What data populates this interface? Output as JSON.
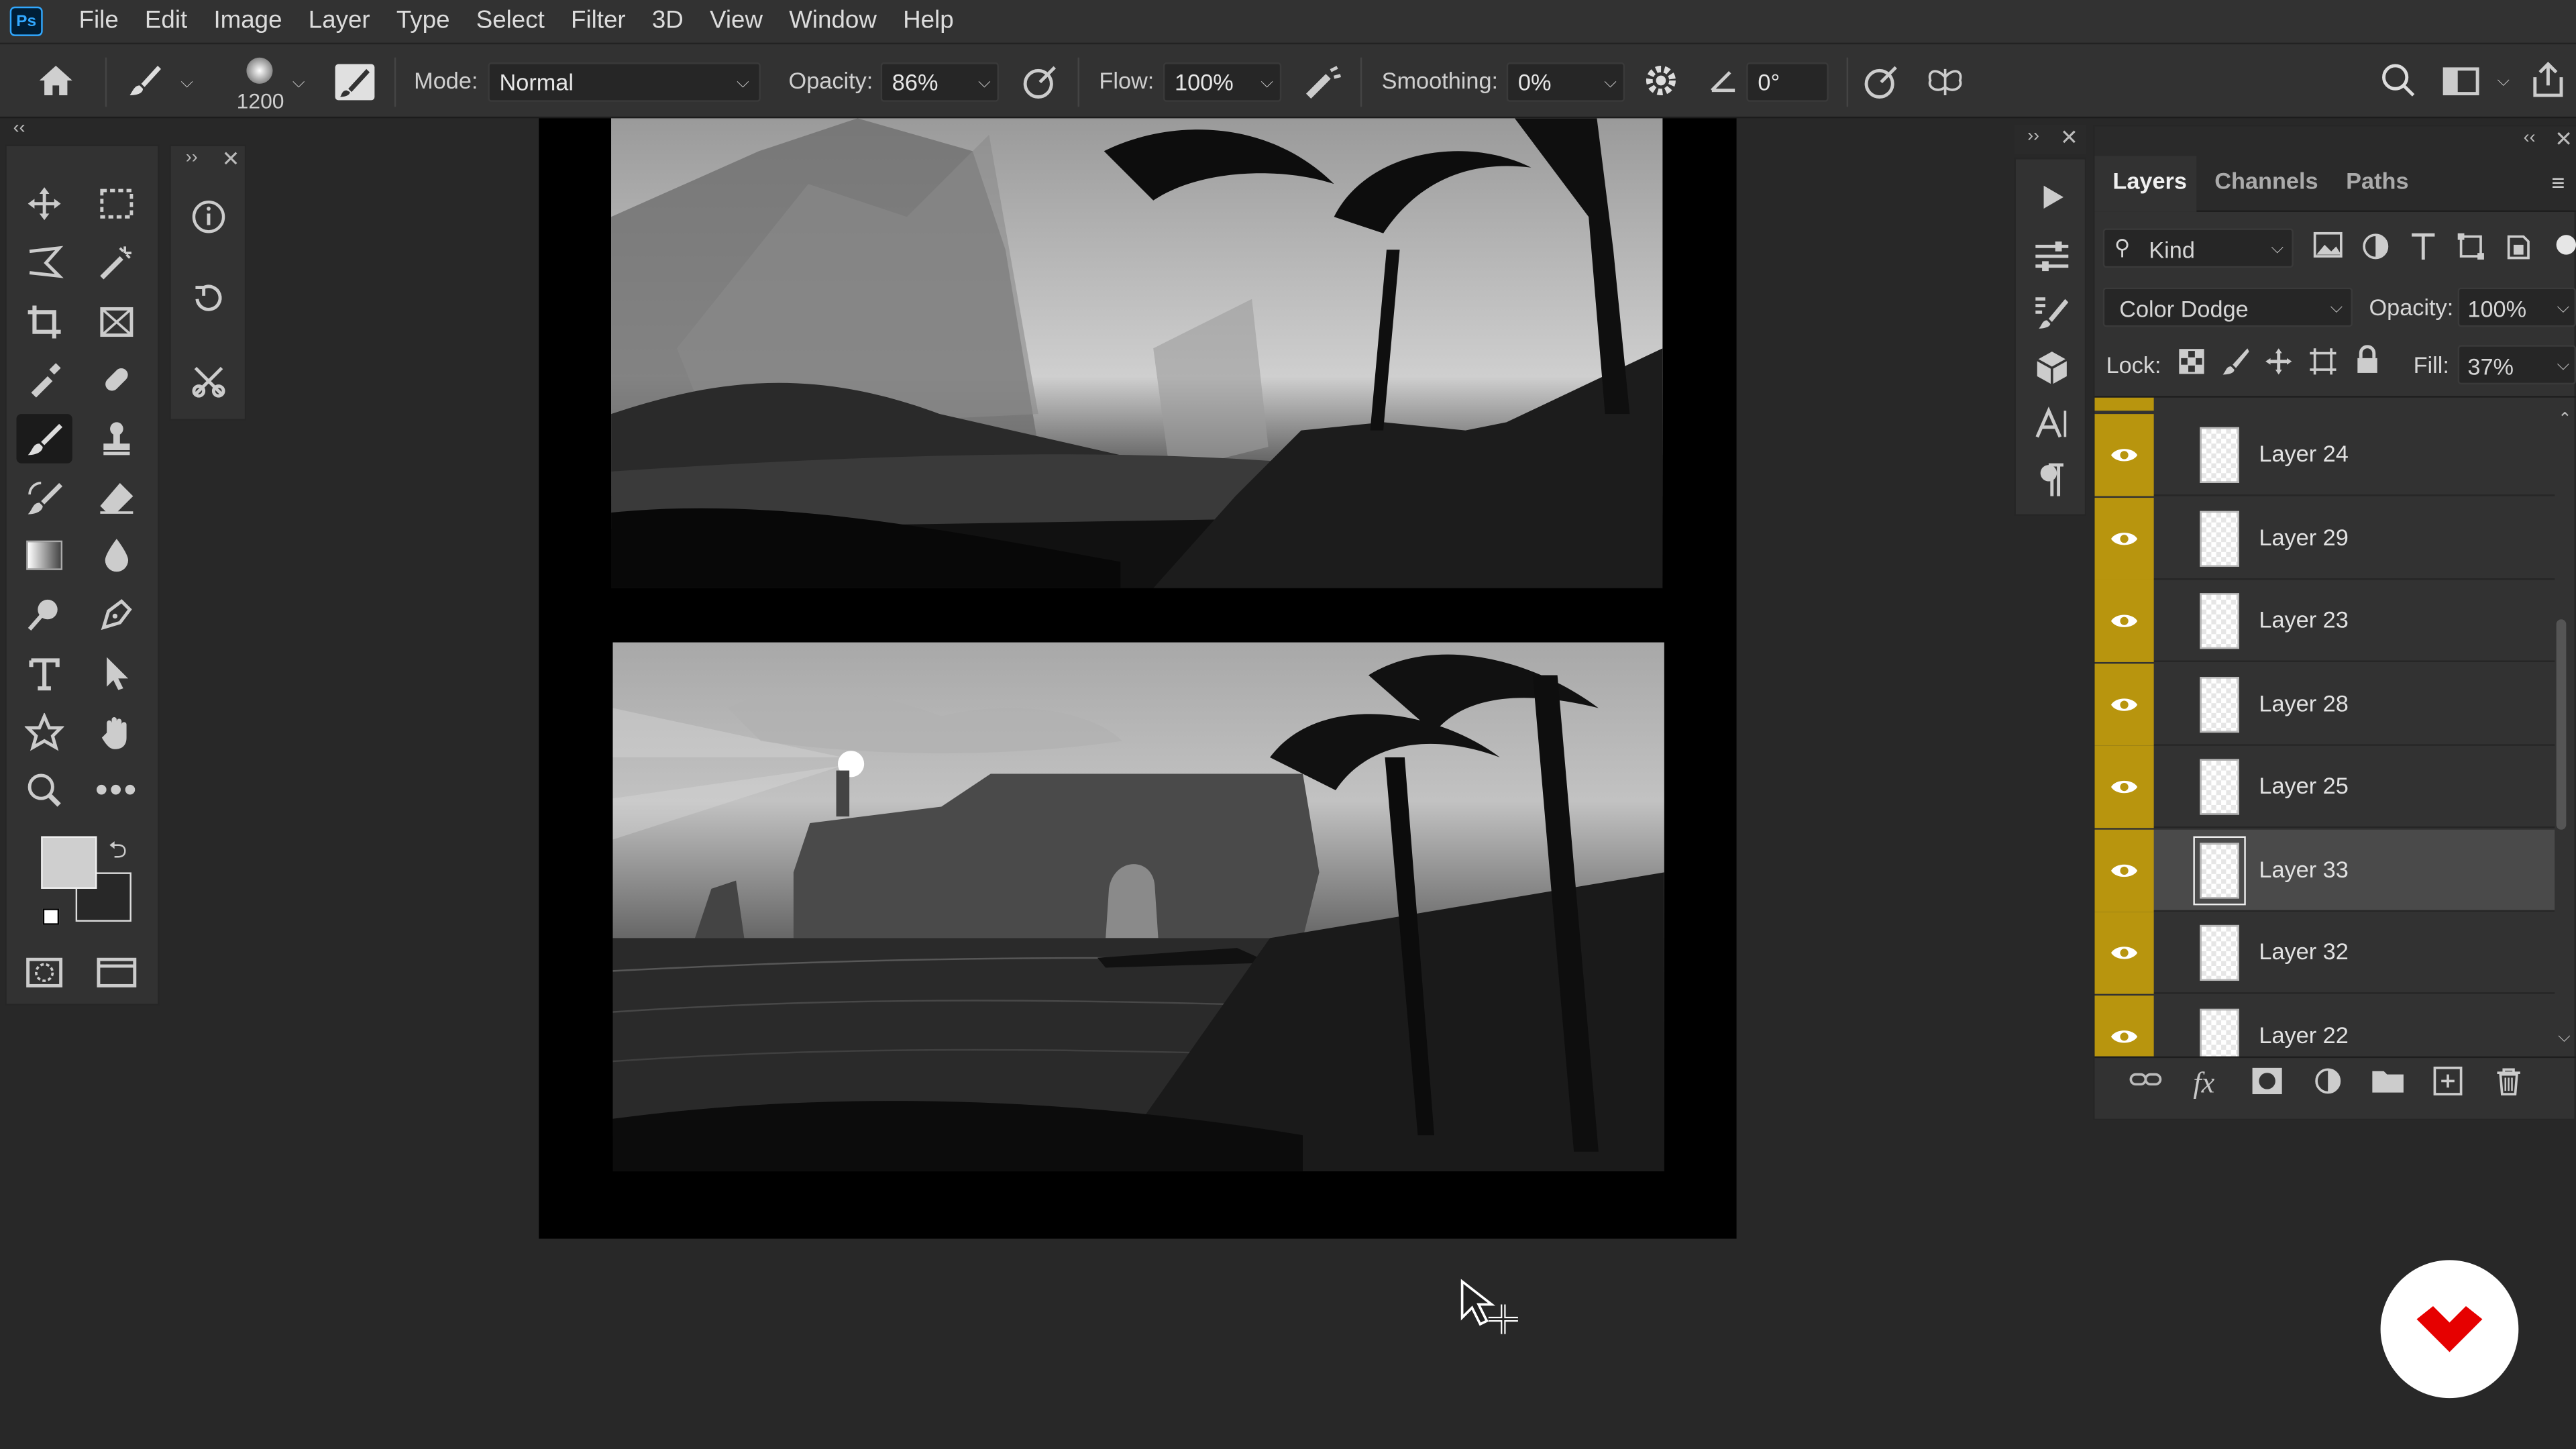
{
  "app": {
    "logo": "Ps"
  },
  "menu": [
    "File",
    "Edit",
    "Image",
    "Layer",
    "Type",
    "Select",
    "Filter",
    "3D",
    "View",
    "Window",
    "Help"
  ],
  "options": {
    "brush_size": "1200",
    "mode_label": "Mode:",
    "mode_value": "Normal",
    "opacity_label": "Opacity:",
    "opacity_value": "86%",
    "flow_label": "Flow:",
    "flow_value": "100%",
    "smoothing_label": "Smoothing:",
    "smoothing_value": "0%",
    "angle_value": "0°"
  },
  "tools": [
    "move-tool",
    "marquee-tool",
    "lasso-tool",
    "magic-wand-tool",
    "crop-tool",
    "frame-tool",
    "eyedropper-tool",
    "healing-tool",
    "brush-tool",
    "stamp-tool",
    "history-brush-tool",
    "eraser-tool",
    "gradient-tool",
    "blur-tool",
    "dodge-tool",
    "pen-tool",
    "type-tool",
    "path-selection-tool",
    "shape-tool",
    "hand-tool",
    "zoom-tool",
    "more-tools"
  ],
  "layers_panel": {
    "tabs": [
      "Layers",
      "Channels",
      "Paths"
    ],
    "filter_kind": "Kind",
    "blend_mode": "Color Dodge",
    "opacity_label": "Opacity:",
    "opacity_value": "100%",
    "lock_label": "Lock:",
    "fill_label": "Fill:",
    "fill_value": "37%",
    "layers": [
      {
        "name": "Layer 24",
        "visible": true,
        "selected": false
      },
      {
        "name": "Layer 29",
        "visible": true,
        "selected": false
      },
      {
        "name": "Layer 23",
        "visible": true,
        "selected": false
      },
      {
        "name": "Layer 28",
        "visible": true,
        "selected": false
      },
      {
        "name": "Layer 25",
        "visible": true,
        "selected": false
      },
      {
        "name": "Layer 33",
        "visible": true,
        "selected": true
      },
      {
        "name": "Layer 32",
        "visible": true,
        "selected": false
      },
      {
        "name": "Layer 22",
        "visible": true,
        "selected": false
      }
    ]
  },
  "colors": {
    "label_color": "#b8950e",
    "selected_row": "#4a4a4a",
    "badge": "#e60000"
  }
}
